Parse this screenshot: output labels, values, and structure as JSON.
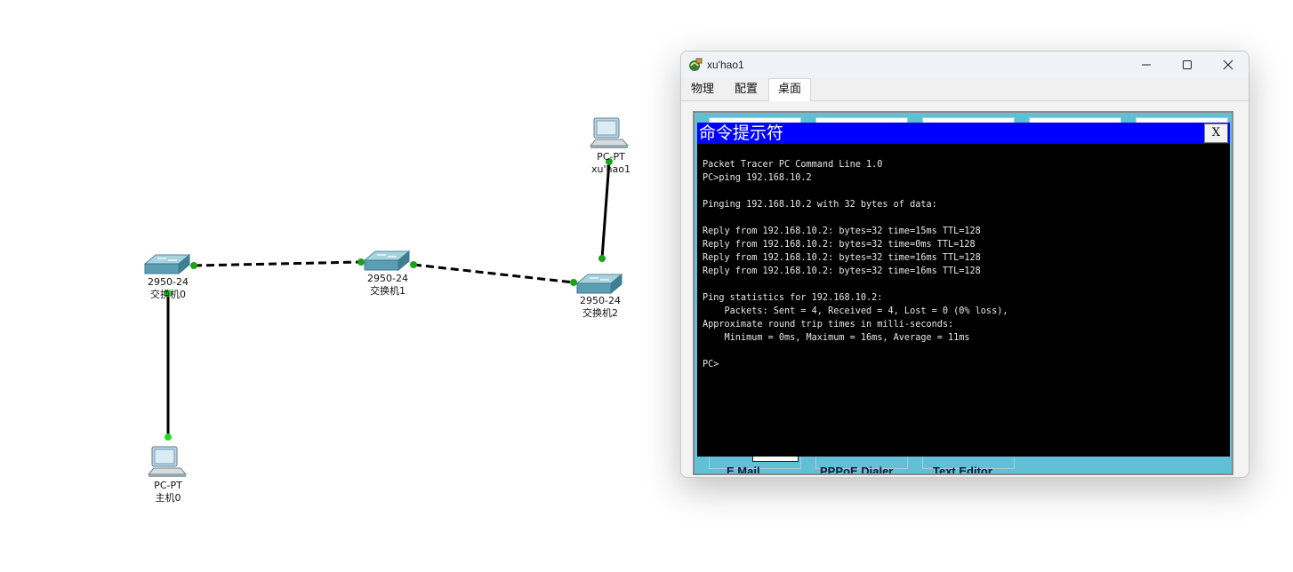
{
  "topology": {
    "devices": [
      {
        "id": "switch0",
        "model": "2950-24",
        "name": "交换机0",
        "icon": "switch-icon"
      },
      {
        "id": "switch1",
        "model": "2950-24",
        "name": "交换机1",
        "icon": "switch-icon"
      },
      {
        "id": "switch2",
        "model": "2950-24",
        "name": "交换机2",
        "icon": "switch-icon"
      },
      {
        "id": "pc0",
        "model": "PC-PT",
        "name": "主机0",
        "icon": "pc-icon"
      },
      {
        "id": "pc1",
        "model": "PC-PT",
        "name": "xu'hao1",
        "icon": "pc-icon"
      }
    ],
    "links": [
      {
        "from": "switch0",
        "to": "switch1",
        "style": "crossover-dashed"
      },
      {
        "from": "switch1",
        "to": "switch2",
        "style": "crossover-dashed"
      },
      {
        "from": "switch0",
        "to": "pc0",
        "style": "straight-solid"
      },
      {
        "from": "switch2",
        "to": "pc1",
        "style": "straight-solid"
      }
    ],
    "link_light_color": "#1aa31a"
  },
  "window": {
    "title": "xu'hao1",
    "minimize_icon": "minimize-icon",
    "maximize_icon": "maximize-icon",
    "close_icon": "close-icon",
    "tabs": [
      {
        "label": "物理",
        "active": false
      },
      {
        "label": "配置",
        "active": false
      },
      {
        "label": "桌面",
        "active": true
      }
    ]
  },
  "desktop": {
    "background": "#62c0d6",
    "visible_apps": [
      "E Mail",
      "PPPoE Dialer",
      "Text Editor"
    ]
  },
  "command_prompt": {
    "title": "命令提示符",
    "close_label": "X",
    "title_bar_color": "#0000ff",
    "lines": [
      "Packet Tracer PC Command Line 1.0",
      "PC>ping 192.168.10.2",
      "",
      "Pinging 192.168.10.2 with 32 bytes of data:",
      "",
      "Reply from 192.168.10.2: bytes=32 time=15ms TTL=128",
      "Reply from 192.168.10.2: bytes=32 time=0ms TTL=128",
      "Reply from 192.168.10.2: bytes=32 time=16ms TTL=128",
      "Reply from 192.168.10.2: bytes=32 time=16ms TTL=128",
      "",
      "Ping statistics for 192.168.10.2:",
      "    Packets: Sent = 4, Received = 4, Lost = 0 (0% loss),",
      "Approximate round trip times in milli-seconds:",
      "    Minimum = 0ms, Maximum = 16ms, Average = 11ms",
      "",
      "PC>"
    ]
  }
}
